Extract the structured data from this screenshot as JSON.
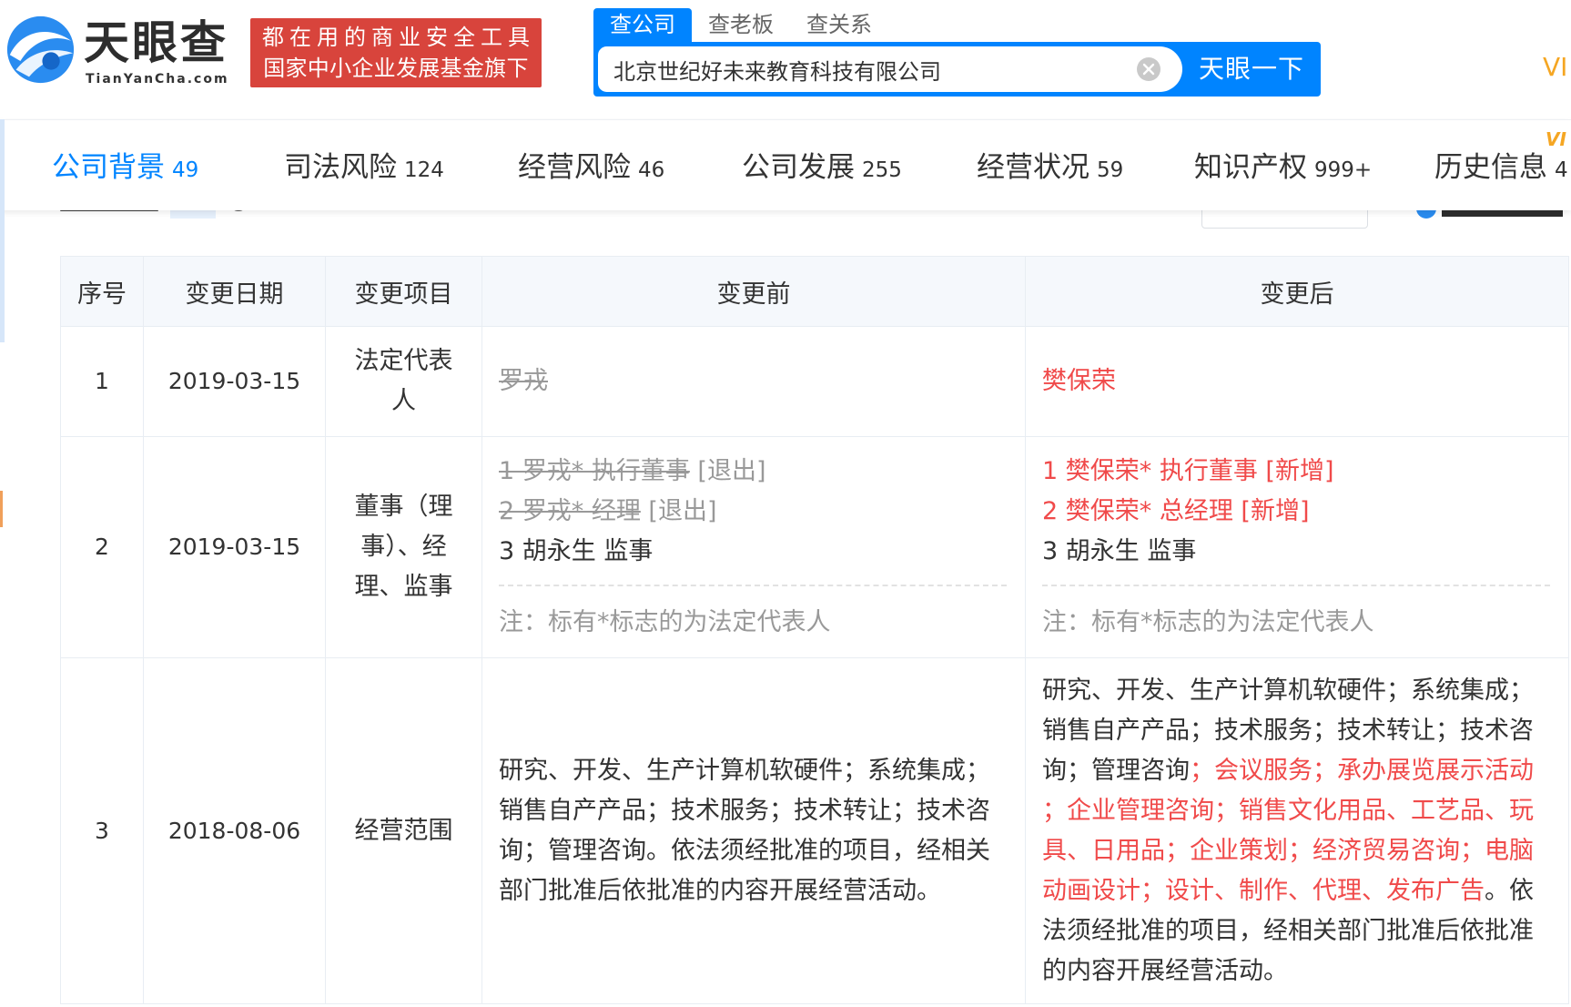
{
  "header": {
    "logo": {
      "icon": "tianyancha-logo-icon",
      "name": "天眼查",
      "domain": "TianYanCha.com"
    },
    "badge": {
      "line1": "都在用的商业安全工具",
      "line2": "国家中小企业发展基金旗下"
    },
    "search": {
      "tabs": [
        {
          "label": "查公司",
          "active": true
        },
        {
          "label": "查老板",
          "active": false
        },
        {
          "label": "查关系",
          "active": false
        }
      ],
      "value": "北京世纪好未来教育科技有限公司",
      "clear_icon": "clear-icon",
      "button_label": "天眼一下"
    },
    "vip_label": "VI"
  },
  "nav": {
    "tabs": [
      {
        "label": "公司背景",
        "count": "49",
        "active": true
      },
      {
        "label": "司法风险",
        "count": "124",
        "active": false
      },
      {
        "label": "经营风险",
        "count": "46",
        "active": false
      },
      {
        "label": "公司发展",
        "count": "255",
        "active": false
      },
      {
        "label": "经营状况",
        "count": "59",
        "active": false
      },
      {
        "label": "知识产权",
        "count": "999+",
        "active": false
      },
      {
        "label": "历史信息",
        "count": "4",
        "active": false
      }
    ],
    "corner_badge": "VI"
  },
  "table": {
    "headers": [
      "序号",
      "变更日期",
      "变更项目",
      "变更前",
      "变更后"
    ],
    "rows": [
      {
        "index": "1",
        "date": "2019-03-15",
        "item": "法定代表人",
        "before": {
          "lines": [
            [
              {
                "text": "罗戎",
                "color": "#999999",
                "strikethrough": true
              }
            ]
          ]
        },
        "after": {
          "lines": [
            [
              {
                "text": "樊保荣",
                "color": "#f04a4a",
                "strikethrough": false
              }
            ]
          ]
        }
      },
      {
        "index": "2",
        "date": "2019-03-15",
        "item": "董事（理事）、经理、监事",
        "before": {
          "lines": [
            [
              {
                "text": "1 罗戎* 执行董事",
                "color": "#999999",
                "strikethrough": true
              },
              {
                "text": " [退出]",
                "color": "#999999",
                "strikethrough": false
              }
            ],
            [
              {
                "text": "2 罗戎* 经理",
                "color": "#999999",
                "strikethrough": true
              },
              {
                "text": " [退出]",
                "color": "#999999",
                "strikethrough": false
              }
            ],
            [
              {
                "text": "3 胡永生 监事",
                "color": "#333333",
                "strikethrough": false
              }
            ]
          ],
          "note": "注：标有*标志的为法定代表人"
        },
        "after": {
          "lines": [
            [
              {
                "text": "1 樊保荣* 执行董事 [新增]",
                "color": "#f04a4a",
                "strikethrough": false
              }
            ],
            [
              {
                "text": "2 樊保荣* 总经理 [新增]",
                "color": "#f04a4a",
                "strikethrough": false
              }
            ],
            [
              {
                "text": "3 胡永生 监事",
                "color": "#333333",
                "strikethrough": false
              }
            ]
          ],
          "note": "注：标有*标志的为法定代表人"
        }
      },
      {
        "index": "3",
        "date": "2018-08-06",
        "item": "经营范围",
        "before": {
          "lines": [
            [
              {
                "text": "研究、开发、生产计算机软硬件；系统集成；销售自产产品；技术服务；技术转让；技术咨询；管理咨询。依法须经批准的项目，经相关部门批准后依批准的内容开展经营活动。",
                "color": "#333333",
                "strikethrough": false
              }
            ]
          ]
        },
        "after": {
          "lines": [
            [
              {
                "text": "研究、开发、生产计算机软硬件；系统集成；销售自产产品；技术服务；技术转让；技术咨询；管理咨询",
                "color": "#333333",
                "strikethrough": false
              },
              {
                "text": "；会议服务；承办展览展示活动；企业管理咨询；销售文化用品、工艺品、玩具、日用品；企业策划；经济贸易咨询；电脑动画设计；设计、制作、代理、发布广告",
                "color": "#f04a4a",
                "strikethrough": false
              },
              {
                "text": "。依法须经批准的项目，经相关部门批准后依批准的内容开展经营活动。",
                "color": "#333333",
                "strikethrough": false
              }
            ]
          ]
        }
      }
    ]
  },
  "colors": {
    "brand_blue": "#0084ff",
    "badge_red": "#d8443c",
    "added_red": "#f04a4a",
    "removed_gray": "#999999",
    "vip_orange": "#f5a623",
    "table_header_bg": "#f5f8fc"
  }
}
